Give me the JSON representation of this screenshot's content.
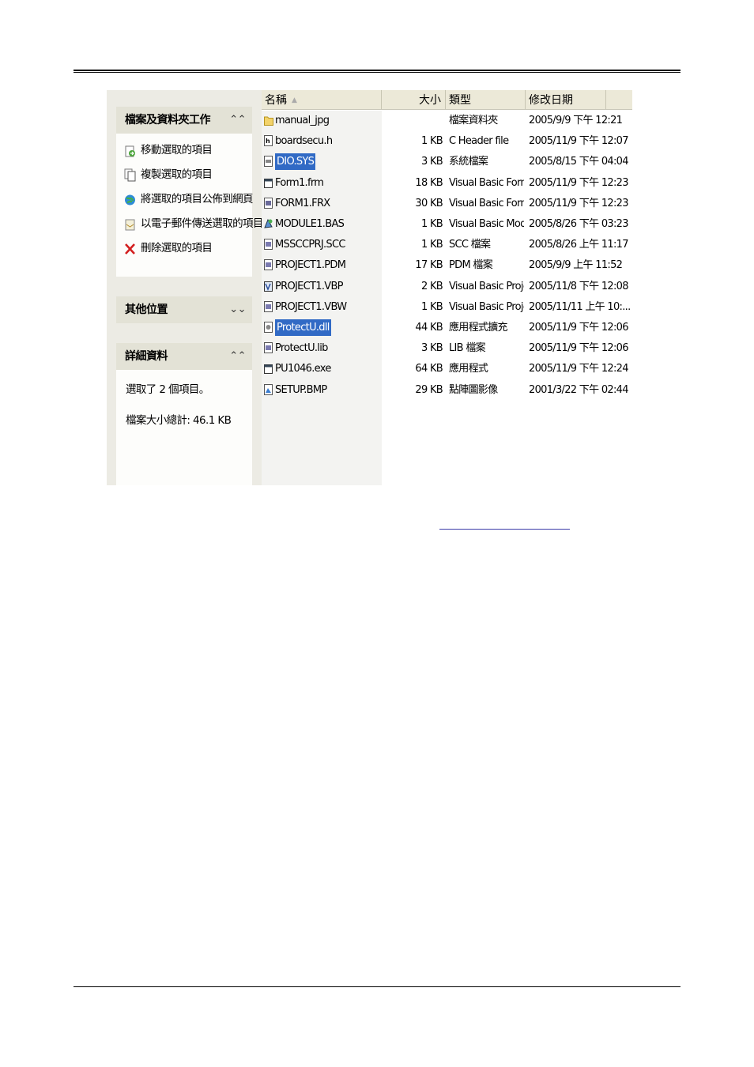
{
  "task_pane": {
    "file_tasks": {
      "title": "檔案及資料夾工作",
      "chevron": "⌃⌃",
      "items": [
        {
          "label": "移動選取的項目",
          "icon": "move-icon"
        },
        {
          "label": "複製選取的項目",
          "icon": "copy-icon"
        },
        {
          "label": "將選取的項目公佈到網頁",
          "icon": "publish-web-icon"
        },
        {
          "label": "以電子郵件傳送選取的項目",
          "icon": "email-icon"
        },
        {
          "label": "刪除選取的項目",
          "icon": "delete-icon"
        }
      ]
    },
    "other_places": {
      "title": "其他位置",
      "chevron": "⌄⌄"
    },
    "details": {
      "title": "詳細資料",
      "chevron": "⌃⌃",
      "selected_count": "選取了 2 個項目。",
      "total_size": "檔案大小總計: 46.1 KB"
    }
  },
  "file_list": {
    "columns": {
      "name": "名稱",
      "size": "大小",
      "type": "類型",
      "date": "修改日期"
    },
    "sort_indicator": "▲",
    "files": [
      {
        "name": "manual_jpg",
        "size": "",
        "type": "檔案資料夾",
        "date": "2005/9/9 下午 12:21",
        "icon": "folder-icon",
        "selected": false
      },
      {
        "name": "boardsecu.h",
        "size": "1 KB",
        "type": "C Header file",
        "date": "2005/11/9 下午 12:07",
        "icon": "header-file-icon",
        "selected": false
      },
      {
        "name": "DIO.SYS",
        "size": "3 KB",
        "type": "系統檔案",
        "date": "2005/8/15 下午 04:04",
        "icon": "system-file-icon",
        "selected": true
      },
      {
        "name": "Form1.frm",
        "size": "18 KB",
        "type": "Visual Basic Form File",
        "date": "2005/11/9 下午 12:23",
        "icon": "vb-form-icon",
        "selected": false
      },
      {
        "name": "FORM1.FRX",
        "size": "30 KB",
        "type": "Visual Basic Form Bi...",
        "date": "2005/11/9 下午 12:23",
        "icon": "binary-file-icon",
        "selected": false
      },
      {
        "name": "MODULE1.BAS",
        "size": "1 KB",
        "type": "Visual Basic Module",
        "date": "2005/8/26 下午 03:23",
        "icon": "vb-module-icon",
        "selected": false
      },
      {
        "name": "MSSCCPRJ.SCC",
        "size": "1 KB",
        "type": "SCC 檔案",
        "date": "2005/8/26 上午 11:17",
        "icon": "generic-file-icon",
        "selected": false
      },
      {
        "name": "PROJECT1.PDM",
        "size": "17 KB",
        "type": "PDM 檔案",
        "date": "2005/9/9 上午 11:52",
        "icon": "generic-file-icon",
        "selected": false
      },
      {
        "name": "PROJECT1.VBP",
        "size": "2 KB",
        "type": "Visual Basic Project",
        "date": "2005/11/8 下午 12:08",
        "icon": "vb-project-icon",
        "selected": false
      },
      {
        "name": "PROJECT1.VBW",
        "size": "1 KB",
        "type": "Visual Basic Project ...",
        "date": "2005/11/11 上午 10:...",
        "icon": "generic-file-icon",
        "selected": false
      },
      {
        "name": "ProtectU.dll",
        "size": "44 KB",
        "type": "應用程式擴充",
        "date": "2005/11/9 下午 12:06",
        "icon": "dll-icon",
        "selected": true
      },
      {
        "name": "ProtectU.lib",
        "size": "3 KB",
        "type": "LIB 檔案",
        "date": "2005/11/9 下午 12:06",
        "icon": "generic-file-icon",
        "selected": false
      },
      {
        "name": "PU1046.exe",
        "size": "64 KB",
        "type": "應用程式",
        "date": "2005/11/9 下午 12:24",
        "icon": "exe-icon",
        "selected": false
      },
      {
        "name": "SETUP.BMP",
        "size": "29 KB",
        "type": "點陣圖影像",
        "date": "2001/3/22 下午 02:44",
        "icon": "bitmap-icon",
        "selected": false
      }
    ]
  }
}
